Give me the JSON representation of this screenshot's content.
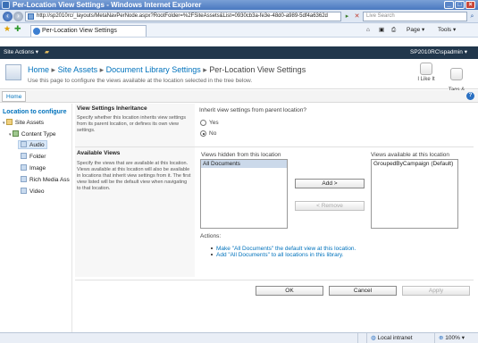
{
  "window": {
    "title": "Per-Location View Settings - Windows Internet Explorer",
    "minimize_glyph": "_",
    "maximize_glyph": "□",
    "close_glyph": "×"
  },
  "browser": {
    "url": "http://sp2010rc/_layouts/MetaNavPerNode.aspx?RootFolder=%2FSiteAssets&List=0930cb3a-fe3e-48d0-a989-5df4a6362d",
    "search_placeholder": "Live Search",
    "tab_title": "Per-Location View Settings",
    "toolbar": {
      "page_label": "Page",
      "tools_label": "Tools"
    }
  },
  "sharepoint": {
    "site_actions": "Site Actions",
    "user": "SP2010RC\\spadmin",
    "breadcrumb": {
      "home": "Home",
      "site_assets": "Site Assets",
      "doc_lib_settings": "Document Library Settings",
      "current": "Per-Location View Settings",
      "sep": "▸"
    },
    "page_description": "Use this page to configure the views available at the location selected in the tree below.",
    "like_it": "I Like It",
    "tags_notes": "Tags &\nNotes",
    "home_tab": "Home",
    "help_glyph": "?"
  },
  "tree": {
    "heading": "Location to configure",
    "root": "Site Assets",
    "content_type": "Content Type",
    "items": [
      "Audio",
      "Folder",
      "Image",
      "Rich Media Ass",
      "Video"
    ],
    "selected": "Audio"
  },
  "inherit": {
    "title": "View Settings Inheritance",
    "description": "Specify whether this location inherits view settings from its parent location, or defines its own view settings.",
    "question": "Inherit view settings from parent location?",
    "yes": "Yes",
    "no": "No",
    "selected": "No"
  },
  "views": {
    "title": "Available Views",
    "description": "Specify the views that are available at this location. Views available at this location will also be available in locations that inherit view settings from it. The first view listed will be the default view when navigating to that location.",
    "hidden_label": "Views hidden from this location",
    "hidden_items": [
      "All Documents"
    ],
    "available_label": "Views available at this location",
    "available_items": [
      "GroupedByCampaign (Default)"
    ],
    "add_button": "Add >",
    "remove_button": "< Remove"
  },
  "actions": {
    "label": "Actions:",
    "items": [
      "Make \"All Documents\" the default view at this location.",
      "Add \"All Documents\" to all locations in this library."
    ]
  },
  "footer_buttons": {
    "ok": "OK",
    "cancel": "Cancel",
    "apply": "Apply"
  },
  "statusbar": {
    "zone": "Local intranet",
    "zoom": "100%"
  }
}
